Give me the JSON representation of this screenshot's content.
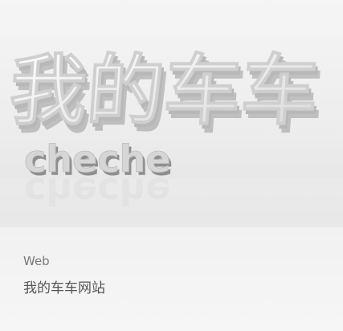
{
  "card": {
    "image": {
      "headline_text": "我的车车",
      "sub_text": "cheche"
    },
    "category": "Web",
    "title": "我的车车网站"
  }
}
